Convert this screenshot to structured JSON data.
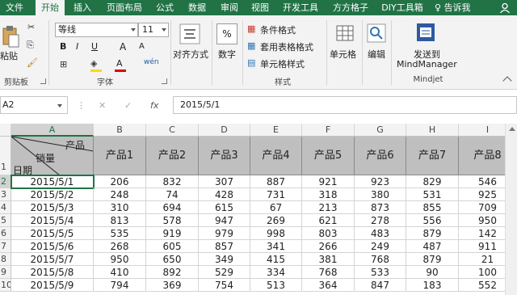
{
  "tabs": [
    {
      "label": "文件",
      "active": false
    },
    {
      "label": "开始",
      "active": true
    },
    {
      "label": "插入",
      "active": false
    },
    {
      "label": "页面布局",
      "active": false
    },
    {
      "label": "公式",
      "active": false
    },
    {
      "label": "数据",
      "active": false
    },
    {
      "label": "审阅",
      "active": false
    },
    {
      "label": "视图",
      "active": false
    },
    {
      "label": "开发工具",
      "active": false
    },
    {
      "label": "方方格子",
      "active": false
    },
    {
      "label": "DIY工具箱",
      "active": false
    }
  ],
  "tell_me": "告诉我",
  "ribbon": {
    "clipboard": {
      "paste": "粘贴",
      "label": "剪贴板"
    },
    "font": {
      "name": "等线",
      "size": "11",
      "bold": "B",
      "italic": "I",
      "underline": "U",
      "grow": "A",
      "shrink": "A",
      "fontcolor": "A",
      "wen": "wén",
      "label": "字体"
    },
    "alignment": {
      "label": "对齐方式"
    },
    "number": {
      "label": "数字",
      "percent": "%"
    },
    "styles": {
      "conditional": "条件格式",
      "table": "套用表格格式",
      "cell": "单元格样式",
      "label": "样式"
    },
    "cells": {
      "label": "单元格"
    },
    "editing": {
      "label": "编辑"
    },
    "mindjet": {
      "send": "发送到",
      "target": "MindManager",
      "label": "Mindjet"
    }
  },
  "formula_bar": {
    "name_box": "A2",
    "cancel": "✕",
    "enter": "✓",
    "fx": "fx",
    "value": "2015/5/1"
  },
  "columns": [
    "A",
    "B",
    "C",
    "D",
    "E",
    "F",
    "G",
    "H",
    "I"
  ],
  "rows": [
    "1",
    "2",
    "3",
    "4",
    "5",
    "6",
    "7",
    "8",
    "9",
    "10"
  ],
  "header_cell": {
    "top": "产品",
    "mid": "销量",
    "bottom": "日期"
  },
  "products": [
    "产品1",
    "产品2",
    "产品3",
    "产品4",
    "产品5",
    "产品6",
    "产品7",
    "产品8"
  ],
  "data": [
    {
      "date": "2015/5/1",
      "values": [
        "206",
        "832",
        "307",
        "887",
        "921",
        "923",
        "829",
        "546"
      ]
    },
    {
      "date": "2015/5/2",
      "values": [
        "248",
        "74",
        "428",
        "731",
        "318",
        "380",
        "531",
        "925"
      ]
    },
    {
      "date": "2015/5/3",
      "values": [
        "310",
        "694",
        "615",
        "67",
        "213",
        "873",
        "855",
        "709"
      ]
    },
    {
      "date": "2015/5/4",
      "values": [
        "813",
        "578",
        "947",
        "269",
        "621",
        "278",
        "556",
        "950"
      ]
    },
    {
      "date": "2015/5/5",
      "values": [
        "535",
        "919",
        "979",
        "998",
        "803",
        "483",
        "879",
        "142"
      ]
    },
    {
      "date": "2015/5/6",
      "values": [
        "268",
        "605",
        "857",
        "341",
        "266",
        "249",
        "487",
        "911"
      ]
    },
    {
      "date": "2015/5/7",
      "values": [
        "950",
        "650",
        "349",
        "415",
        "381",
        "768",
        "879",
        "21"
      ]
    },
    {
      "date": "2015/5/8",
      "values": [
        "410",
        "892",
        "529",
        "334",
        "768",
        "533",
        "90",
        "100"
      ]
    },
    {
      "date": "2015/5/9",
      "values": [
        "794",
        "369",
        "754",
        "513",
        "364",
        "847",
        "183",
        "552"
      ]
    }
  ],
  "colors": {
    "accent": "#217346",
    "header_fill": "#bfbfbf"
  }
}
